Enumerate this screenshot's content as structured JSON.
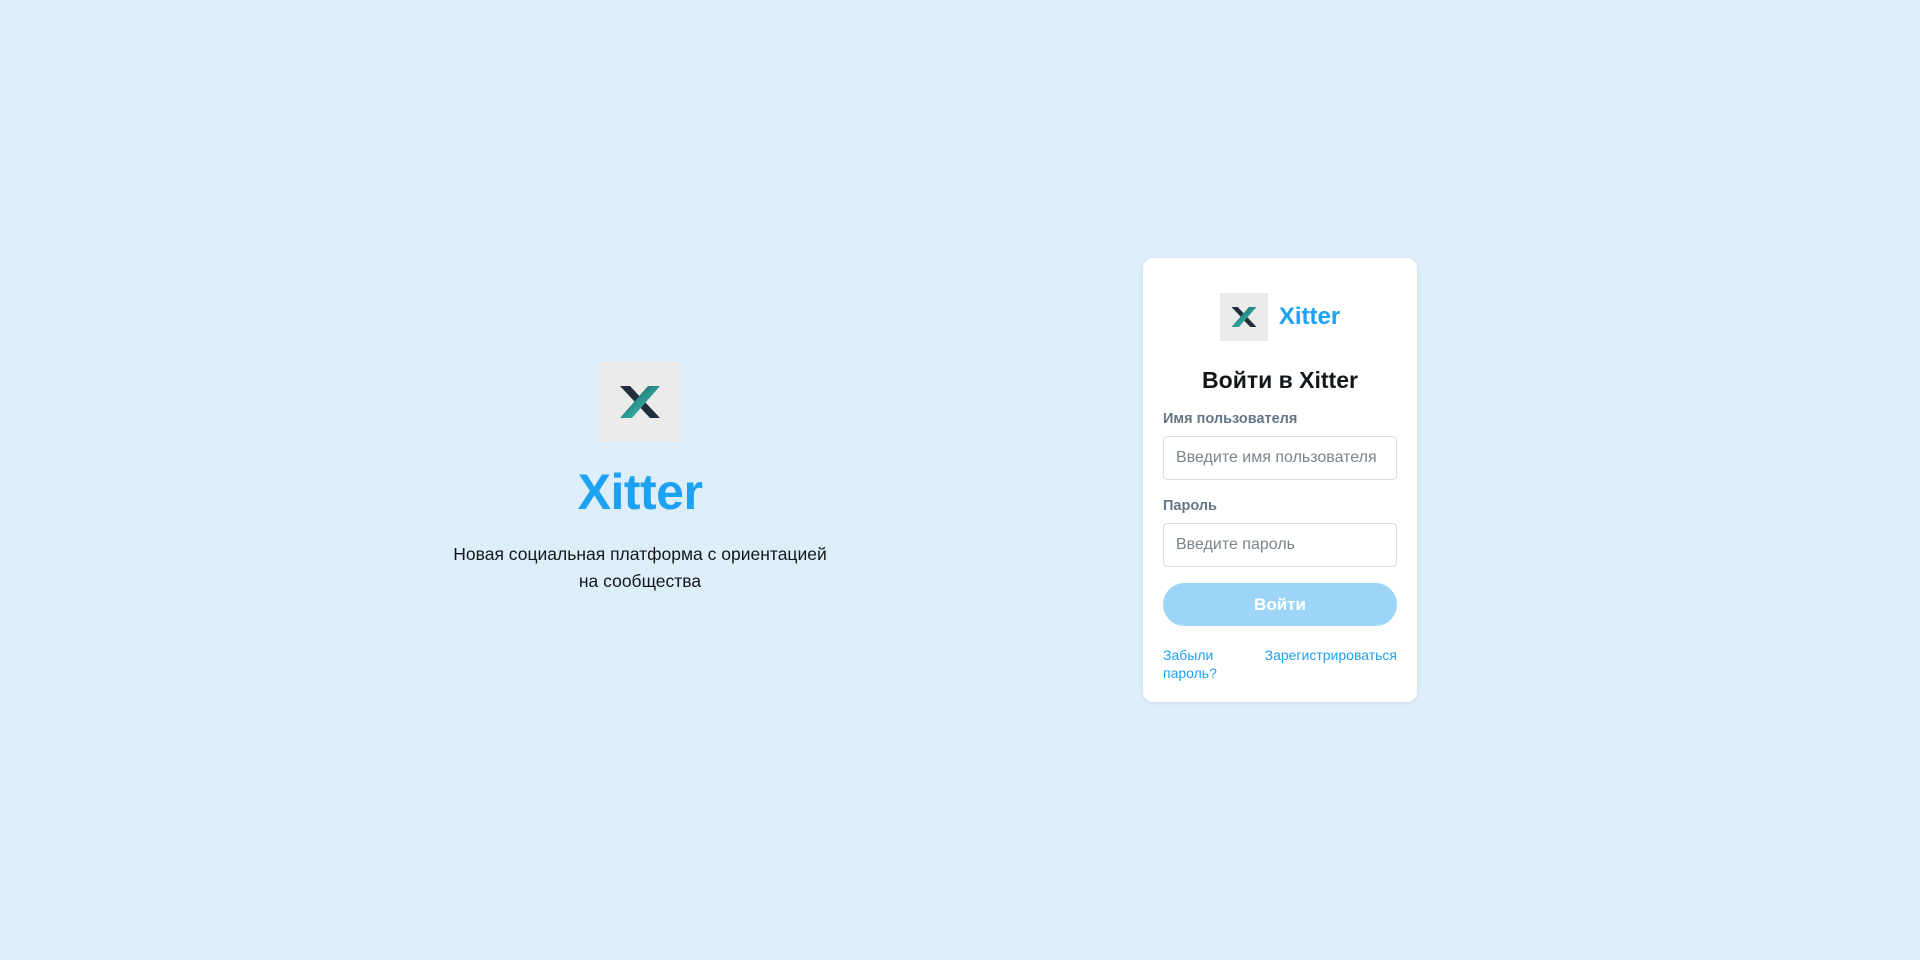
{
  "hero": {
    "logo_icon": "xitter-x-logo-icon",
    "title": "Xitter",
    "tagline": "Новая социальная платформа с ориентацией на сообщества"
  },
  "login_card": {
    "brand_icon": "xitter-x-logo-icon",
    "brand_name": "Xitter",
    "heading": "Войти в Xitter",
    "username_label": "Имя пользователя",
    "username_placeholder": "Введите имя пользователя",
    "username_value": "",
    "password_label": "Пароль",
    "password_placeholder": "Введите пароль",
    "password_value": "",
    "submit_label": "Войти",
    "forgot_password_link": "Забыли пароль?",
    "register_link": "Зарегистрироваться"
  },
  "colors": {
    "page_background": "#ddeef8",
    "brand_blue": "#1da1f2",
    "button_disabled": "#9dd5f9",
    "card_background": "#ffffff",
    "label_gray": "#657786",
    "logo_dark": "#1f2d3d",
    "logo_teal": "#2ec4b6"
  }
}
